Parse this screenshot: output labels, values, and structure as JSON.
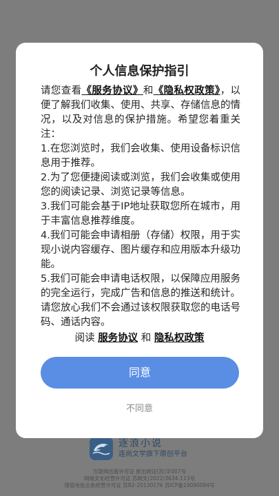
{
  "splash": {
    "app_name": "逐浪小说",
    "tagline": "连尚文学旗下原创平台",
    "legal_lines": [
      "互联网出版许可证 新出网证(苏)字007号",
      "网络文化经营许可证 苏网文(2022)3634-113号",
      "增值电信业务经营许可证 苏B2-20130176  苏ICP备19090094号"
    ],
    "logo_icon": "dolphin-icon",
    "brand_color": "#3a5f86"
  },
  "dialog": {
    "title": "个人信息保护指引",
    "intro_before": "请您查看",
    "service_link": "《服务协议》",
    "and": "和",
    "privacy_link": "《隐私权政策》",
    "intro_after": "，以便了解我们收集、使用、共享、存储信息的情况，以及对信息的保护措施。希望您着重关注：",
    "items": [
      "1.在您浏览时，我们会收集、使用设备标识信息用于推荐。",
      "2.为了您便捷阅读或浏览，我们会收集或使用您的阅读记录、浏览记录等信息。",
      "3.我们可能会基于IP地址获取您所在城市，用于丰富信息推荐维度。",
      "4.我们可能会申请相册（存储）权限，用于实现小说内容缓存、图片缓存和应用版本升级功能。",
      "5.我们可能会申请电话权限，以保障应用服务的完全运行，完成广告和信息的推送和统计。请您放心我们不会通过该权限获取您的电话号码、通话内容。"
    ],
    "read_prefix": "阅读",
    "read_service": "服务协议",
    "read_and": "和",
    "read_privacy": "隐私权政策",
    "agree_label": "同意",
    "disagree_label": "不同意",
    "accent_color": "#5a8ee5"
  }
}
